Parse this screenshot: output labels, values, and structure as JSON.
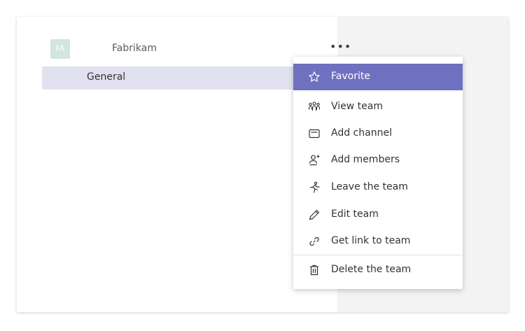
{
  "team": {
    "avatar_initials": "FA",
    "name": "Fabrikam",
    "more_label": "•••"
  },
  "channel": {
    "name": "General"
  },
  "menu": {
    "items": [
      {
        "label": "Favorite",
        "icon": "star-icon"
      },
      {
        "label": "View team",
        "icon": "people-icon"
      },
      {
        "label": "Add channel",
        "icon": "channel-icon"
      },
      {
        "label": "Add members",
        "icon": "add-member-icon"
      },
      {
        "label": "Leave the team",
        "icon": "leave-icon"
      },
      {
        "label": "Edit team",
        "icon": "pencil-icon"
      },
      {
        "label": "Get link to team",
        "icon": "link-icon"
      },
      {
        "label": "Delete the team",
        "icon": "trash-icon"
      }
    ]
  },
  "colors": {
    "accent": "#6f70bf",
    "selected_row": "#e1e1ef",
    "avatar": "#d2e5df"
  }
}
